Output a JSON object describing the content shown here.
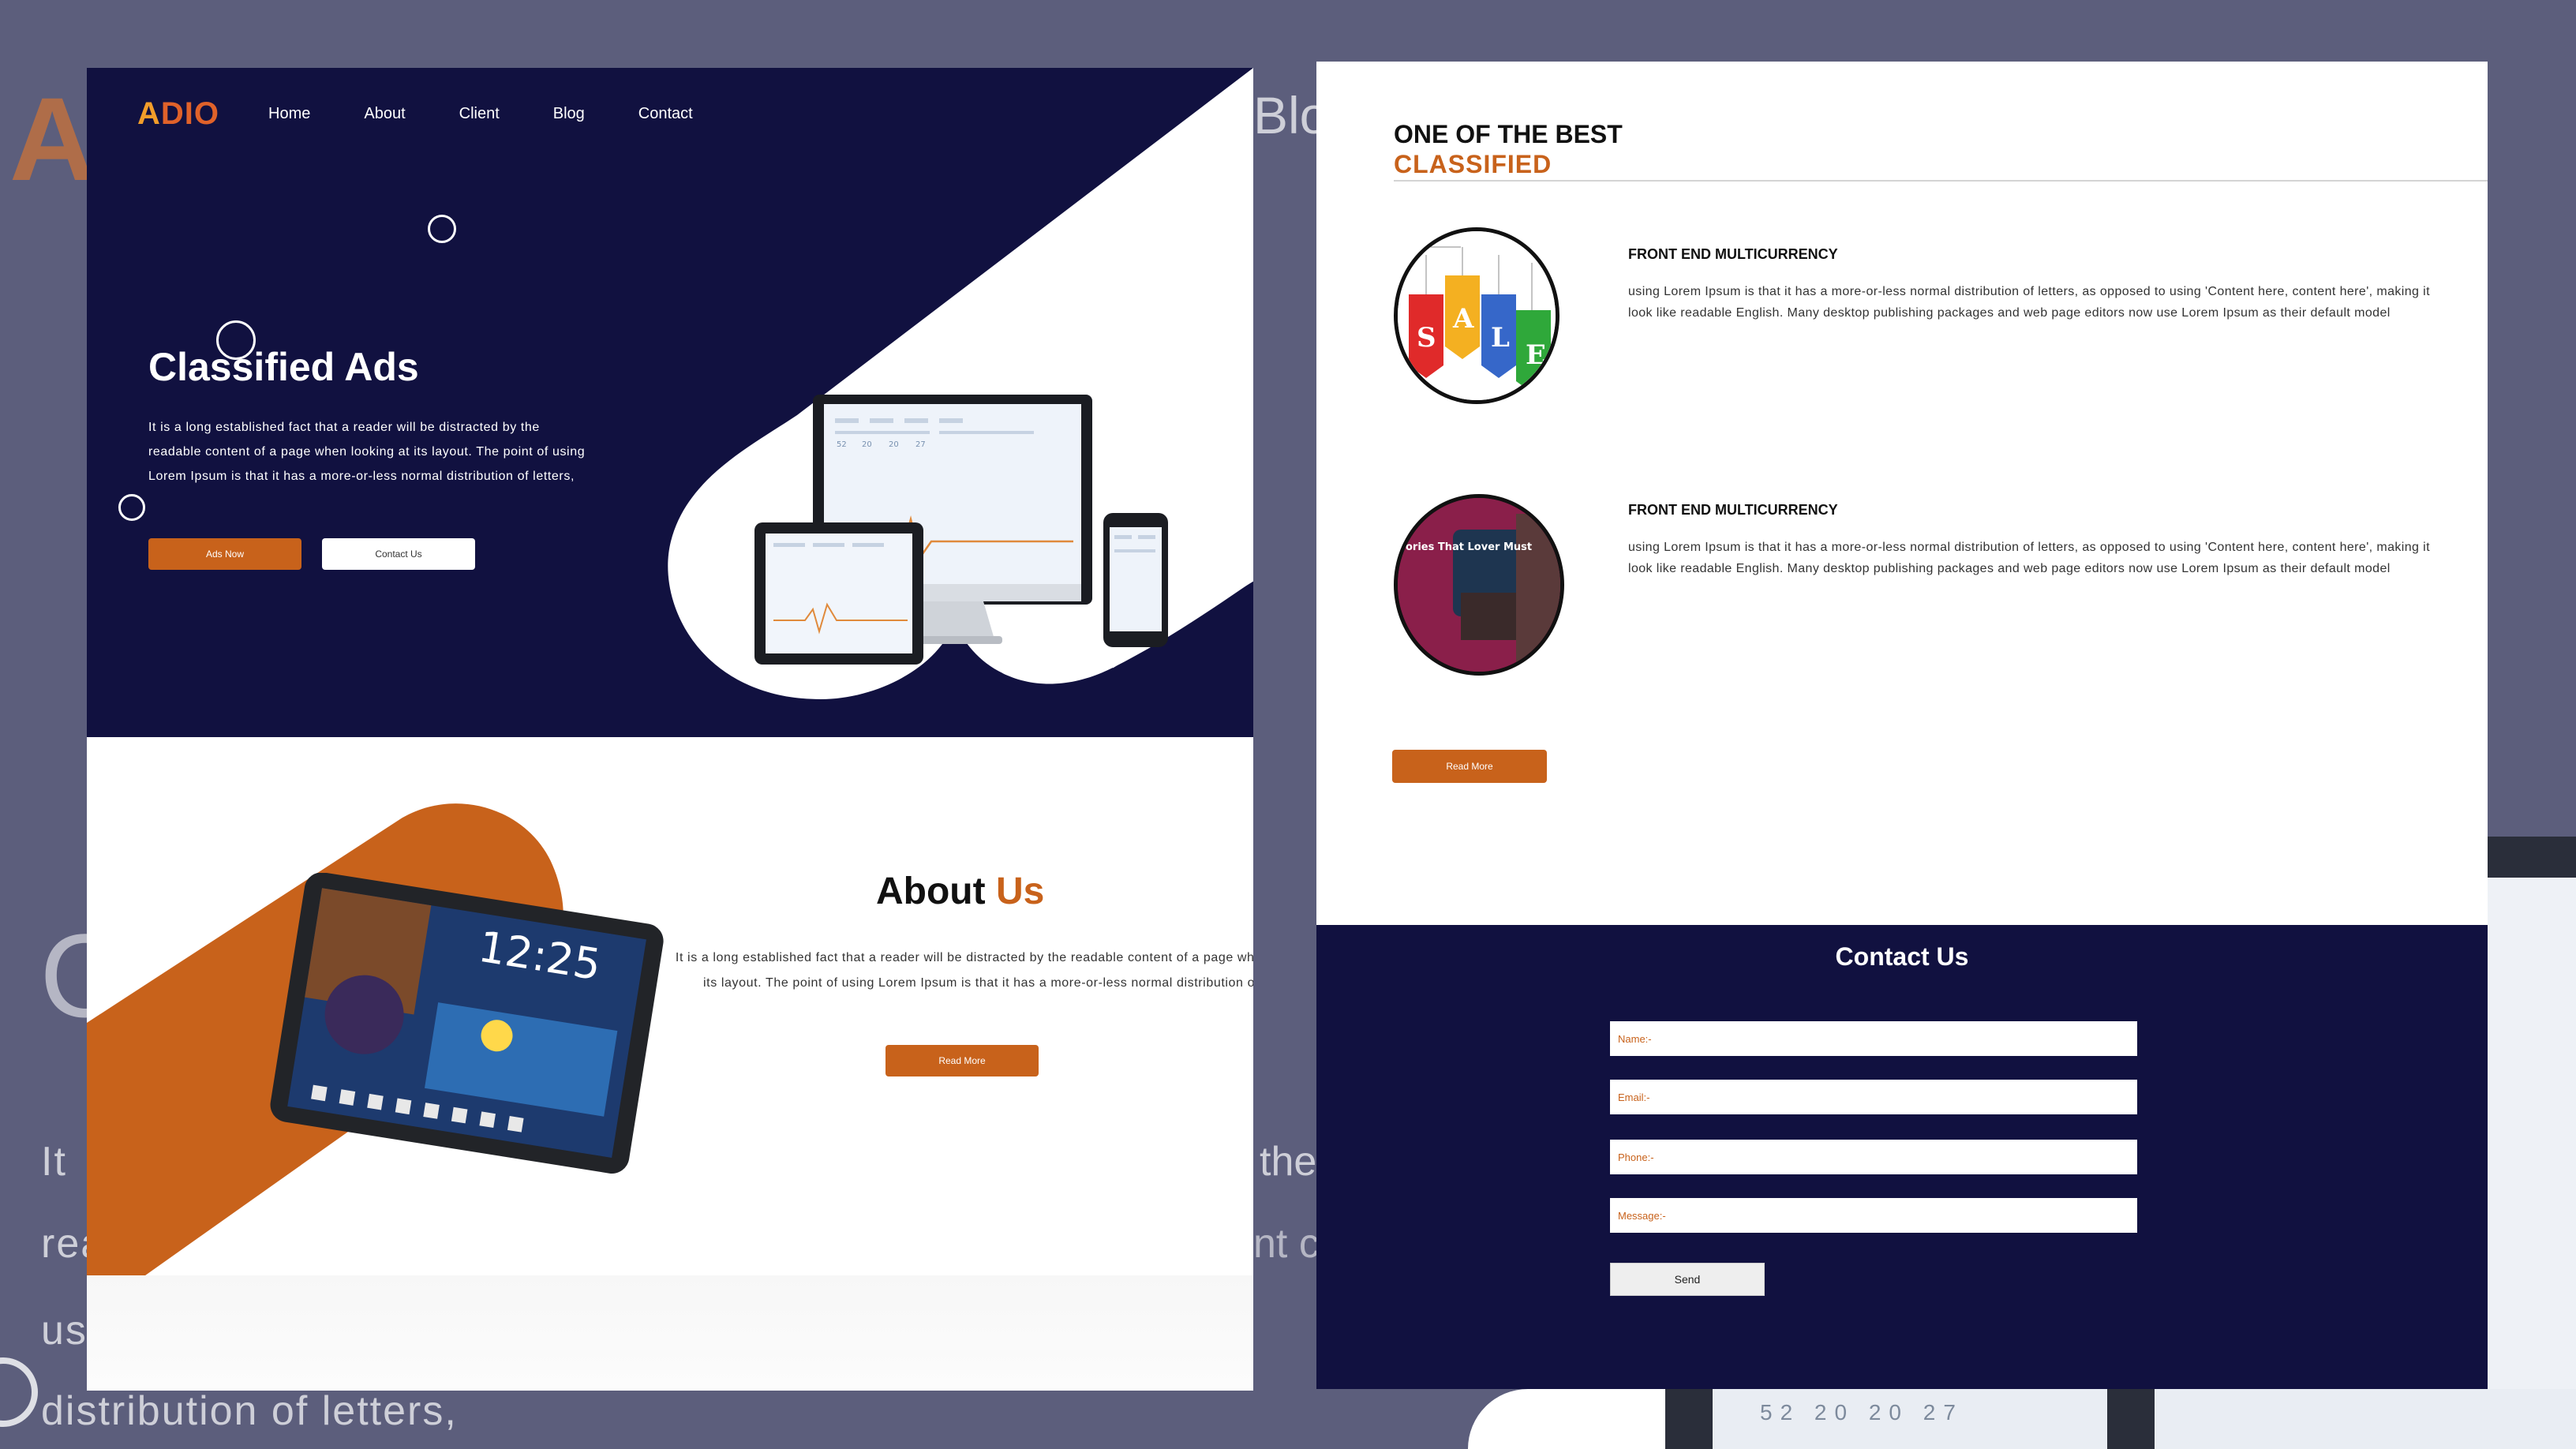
{
  "background": {
    "ad_fragment": "A",
    "blog_fragment": "Blo",
    "c_fragment": "C",
    "text_lines": [
      "It",
      "rea",
      "us",
      "distribution of letters,"
    ],
    "the_fragment": "the",
    "nt_fragment": "nt c",
    "strip_numbers": "52 20 20 27"
  },
  "left": {
    "logo": {
      "a": "A",
      "rest": "DIO"
    },
    "nav": [
      "Home",
      "About",
      "Client",
      "Blog",
      "Contact"
    ],
    "hero": {
      "title": "Classified Ads",
      "text": "It is a long established fact that a reader will be distracted by the readable content of a page when looking at its layout. The point of using Lorem Ipsum is that it has a more-or-less normal distribution of letters,",
      "ads_button": "Ads Now",
      "contact_button": "Contact Us"
    },
    "about": {
      "title_main": "About",
      "title_accent": "Us",
      "text": "It is a long established fact that a reader will be distracted by the readable content of a page when looking at its layout. The point of using Lorem Ipsum is that it has a more-or-less normal distribution of letters,",
      "button": "Read More"
    },
    "tablet_clock": "12:25"
  },
  "right": {
    "heading_line1": "ONE OF THE BEST",
    "heading_line2": "CLASSIFIED",
    "features": [
      {
        "title": "FRONT END MULTICURRENCY",
        "text": "using Lorem Ipsum is that it has a more-or-less normal distribution of letters, as opposed to using 'Content here, content here', making it look like readable English. Many desktop publishing packages and web page editors now use Lorem Ipsum as their default model",
        "image_letters": [
          "S",
          "A",
          "L",
          "E"
        ]
      },
      {
        "title": "FRONT END MULTICURRENCY",
        "text": "using Lorem Ipsum is that it has a more-or-less normal distribution of letters, as opposed to using 'Content here, content here', making it look like readable English. Many desktop publishing packages and web page editors now use Lorem Ipsum as their default model",
        "image_caption": "ories That Lover Must"
      }
    ],
    "read_more": "Read More",
    "contact": {
      "title": "Contact Us",
      "name_placeholder": "Name:-",
      "email_placeholder": "Email:-",
      "phone_placeholder": "Phone:-",
      "message_placeholder": "Message:-",
      "send": "Send"
    }
  },
  "colors": {
    "navy": "#111140",
    "orange": "#c8621b",
    "backdrop": "#5c5e7c"
  },
  "icons": [
    "ring-icon",
    "sale-tags-icon",
    "devices-illustration",
    "tablet-illustration"
  ]
}
